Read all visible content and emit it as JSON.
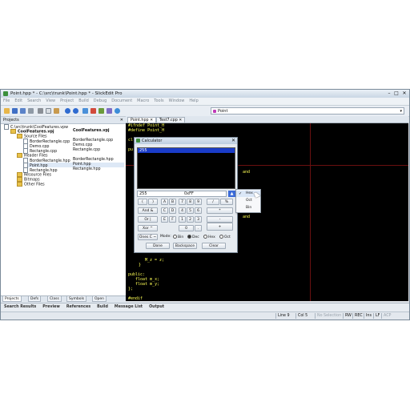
{
  "window": {
    "title": "Point.hpp * - C:\\src\\trunk\\Point.hpp * - SlickEdit Pro",
    "min_glyph": "–",
    "max_glyph": "□",
    "close_glyph": "✕"
  },
  "menu": [
    "File",
    "Edit",
    "Search",
    "View",
    "Project",
    "Build",
    "Debug",
    "Document",
    "Macro",
    "Tools",
    "Window",
    "Help"
  ],
  "toolbar": {
    "icons": [
      "open-icon",
      "save-icon",
      "save-all-icon",
      "print-icon",
      "cut-icon",
      "copy-icon",
      "paste-icon",
      "undo-icon",
      "redo-icon",
      "find-icon",
      "build-icon",
      "debug-icon",
      "tools-icon",
      "help-icon"
    ],
    "symbol_combo_value": "Point",
    "symbol_combo_arrow": "▾"
  },
  "projects": {
    "header": "Projects",
    "close_glyph": "✕",
    "workspace": "C:\\src\\trunk\\CoolFeatures.vpw",
    "project": "CoolFeatures.vpj",
    "project_right": "CoolFeatures.vpj",
    "source_folder": "Source Files",
    "source_files": [
      {
        "name": "BorderRectangle.cpp",
        "right": "BorderRectangle.cpp"
      },
      {
        "name": "Demo.cpp",
        "right": "Demo.cpp"
      },
      {
        "name": "Rectangle.cpp",
        "right": "Rectangle.cpp"
      }
    ],
    "header_folder": "Header Files",
    "header_files": [
      {
        "name": "BorderRectangle.hpp",
        "right": "BorderRectangle.hpp"
      },
      {
        "name": "Point.hpp",
        "right": "Point.hpp"
      },
      {
        "name": "Rectangle.hpp",
        "right": "Rectangle.hpp"
      }
    ],
    "other_folders": [
      "Resource Files",
      "Bitmaps",
      "Other Files"
    ],
    "bottom_tabs": [
      "Projects",
      "Defs",
      "Class",
      "Symbols",
      "Open"
    ]
  },
  "output_tabs": [
    "Search Results",
    "Preview",
    "References",
    "Build",
    "Message List",
    "Output"
  ],
  "status": {
    "line": "Line 9",
    "col": "Col 5",
    "selection": "No Selection",
    "rw": "RW",
    "rec": "REC",
    "ins": "Ins",
    "eol": "LF",
    "enc": "ACP"
  },
  "doc_tabs": [
    {
      "label": "Point.hpp",
      "close": "✕"
    },
    {
      "label": "Test7.cpp",
      "close": "✕"
    }
  ],
  "editor": {
    "lines_top": [
      "#ifndef Point_H",
      "#define Point_H"
    ],
    "line_class_fragment": "cl",
    "line_pub_fragment": "pu",
    "and_labels": [
      "and",
      "and"
    ],
    "lines_bottom_1": [
      "M_z = z;",
      "}"
    ],
    "lines_bottom_2": [
      "public:",
      "   float m_x;",
      "   float m_y;",
      "};"
    ],
    "line_endif": "#endif"
  },
  "calculator": {
    "title": "Calculator",
    "close_glyph": "✕",
    "display_value": "255",
    "input_value": "255",
    "input_hex": "0xFF",
    "base_button": "▲",
    "keys": [
      [
        "(",
        ")",
        "A",
        "B",
        "7",
        "8",
        "9",
        "/",
        "%"
      ],
      [
        "And &",
        "C",
        "D",
        "4",
        "5",
        "6",
        "*"
      ],
      [
        "Or |",
        "E",
        "F",
        "1",
        "2",
        "3",
        "-"
      ],
      [
        "Xor ^",
        "0",
        ".",
        "+"
      ],
      [
        "Ones C ~"
      ]
    ],
    "mode_label": "Mode:",
    "modes": [
      "Bin",
      "Dec",
      "Hex",
      "Oct"
    ],
    "selected_mode": "Dec",
    "buttons": [
      "Done",
      "Backspace",
      "Clear"
    ]
  },
  "base_popup": {
    "items": [
      "Hex",
      "Oct",
      "Bin"
    ],
    "checked": "Hex",
    "check_glyph": "✓"
  }
}
